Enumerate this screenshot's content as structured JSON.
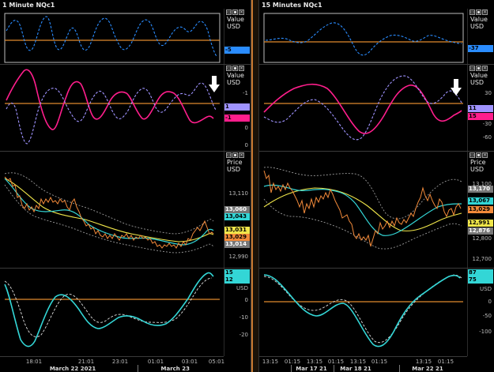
{
  "colors": {
    "zero_line": "#e08a2c",
    "value_blue": "#2a8cff",
    "value_magenta": "#ff1e8c",
    "value_lavender": "#9f93ff",
    "price_orange": "#f28a3a",
    "price_cyan": "#33d6d6",
    "price_yellow": "#f0e64a",
    "price_gray": "#9a9a9a",
    "bottom_cyan": "#33d6d6",
    "bottom_white": "#e0e0e0"
  },
  "left": {
    "title": "1 Minute NQc1",
    "pane1": {
      "label_top": "Value",
      "label_bottom": "USD",
      "flag_value": "-5"
    },
    "pane2": {
      "label_top": "Value",
      "label_bottom": "USD",
      "ticks": [
        "-1",
        "0",
        "0"
      ],
      "flag_lavender": "1",
      "flag_magenta": "-1"
    },
    "pane3": {
      "label_top": "Price",
      "label_bottom": "USD",
      "ticks": [
        "13,110",
        "13,060",
        "13,010",
        "12,990"
      ],
      "flags": [
        "13,060",
        "13,043",
        "13,031",
        "13,029",
        "13,014"
      ]
    },
    "pane4": {
      "flags": [
        "15",
        "12"
      ],
      "ticks": [
        "USD",
        "0",
        "-10",
        "-20"
      ]
    },
    "xaxis": {
      "ticks": [
        "18:01",
        "21:01",
        "23:01",
        "01:01",
        "03:01",
        "05:01"
      ],
      "dates": [
        "March 22 2021",
        "March 23 2021"
      ]
    }
  },
  "right": {
    "title": "15 Minutes NQc1",
    "pane1": {
      "label_top": "Value",
      "label_bottom": "USD",
      "flag_value": "-37"
    },
    "pane2": {
      "label_top": "Value",
      "label_bottom": "USD",
      "ticks": [
        "30",
        "0",
        "-30",
        "-60"
      ],
      "flag_lavender": "11",
      "flag_magenta": "15"
    },
    "pane3": {
      "label_top": "Price",
      "label_bottom": "USD",
      "ticks": [
        "13,100",
        "12,900",
        "12,800",
        "12,700"
      ],
      "flags": [
        "13,170",
        "13,067",
        "13,029",
        "12,991",
        "12,876"
      ]
    },
    "pane4": {
      "flags": [
        "87",
        "75"
      ],
      "ticks": [
        "USD",
        "0",
        "-50",
        "-100"
      ]
    },
    "xaxis": {
      "ticks": [
        "13:15",
        "01:15",
        "13:15",
        "01:15",
        "13:15",
        "01:15",
        "13:15",
        "01:15"
      ],
      "dates": [
        "Mar 17 21",
        "Mar 18 21",
        "Mar 22 21"
      ]
    }
  }
}
